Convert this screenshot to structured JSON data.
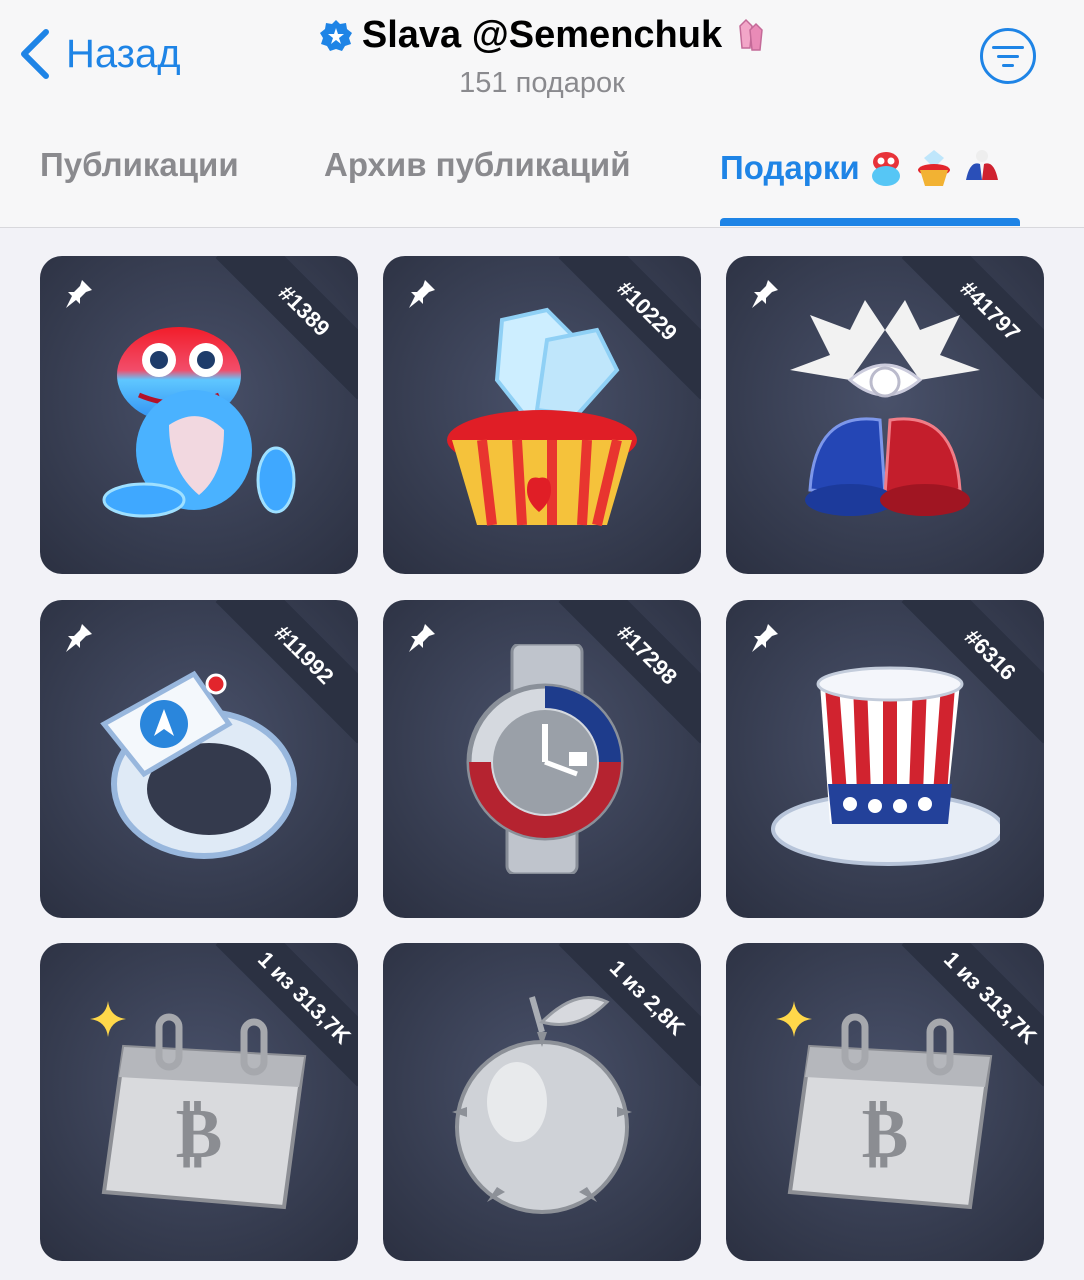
{
  "header": {
    "back_label": "Назад",
    "title": "Slava @Semenchuk",
    "subtitle": "151 подарок"
  },
  "tabs": [
    {
      "label": "Публикации",
      "active": false
    },
    {
      "label": "Архив публикаций",
      "active": false
    },
    {
      "label": "Подарки",
      "active": true
    }
  ],
  "colors": {
    "accent": "#1e84e6",
    "card_bg": "#343a4d",
    "header_bg": "#f7f7f8",
    "muted_text": "#8a8a8e"
  },
  "gifts": [
    {
      "badge": "#1389",
      "icon": "frog-hugging-heart",
      "pinned": true,
      "sparkle": false
    },
    {
      "badge": "#10229",
      "icon": "ice-heart-cupcake",
      "pinned": true,
      "sparkle": false
    },
    {
      "badge": "#41797",
      "icon": "jingle-bells",
      "pinned": true,
      "sparkle": false
    },
    {
      "badge": "#11992",
      "icon": "signet-ring",
      "pinned": true,
      "sparkle": false
    },
    {
      "badge": "#17298",
      "icon": "wrist-watch",
      "pinned": true,
      "sparkle": false
    },
    {
      "badge": "#6316",
      "icon": "top-hat",
      "pinned": true,
      "sparkle": false
    },
    {
      "badge": "1 из 313,7K",
      "icon": "bitcoin-calendar",
      "pinned": false,
      "sparkle": true
    },
    {
      "badge": "1 из 2,8K",
      "icon": "spiky-silver-apple",
      "pinned": false,
      "sparkle": false
    },
    {
      "badge": "1 из 313,7K",
      "icon": "bitcoin-calendar",
      "pinned": false,
      "sparkle": true
    }
  ]
}
